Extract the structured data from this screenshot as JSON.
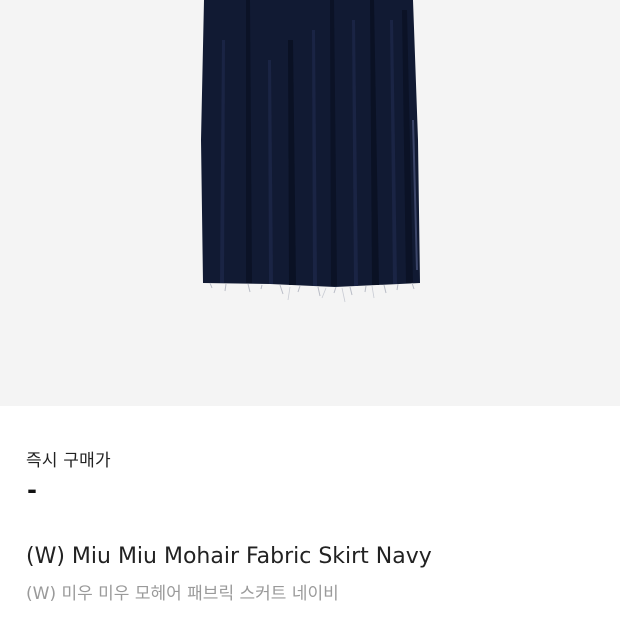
{
  "product": {
    "image_icon": "pleated-skirt-photo",
    "skirt_color": "#111a33",
    "background_color": "#f4f4f4"
  },
  "purchase": {
    "label": "즉시 구매가",
    "price": "-"
  },
  "title": {
    "english": "(W) Miu Miu Mohair Fabric Skirt Navy",
    "korean": "(W) 미우 미우 모헤어 패브릭 스커트 네이비"
  }
}
